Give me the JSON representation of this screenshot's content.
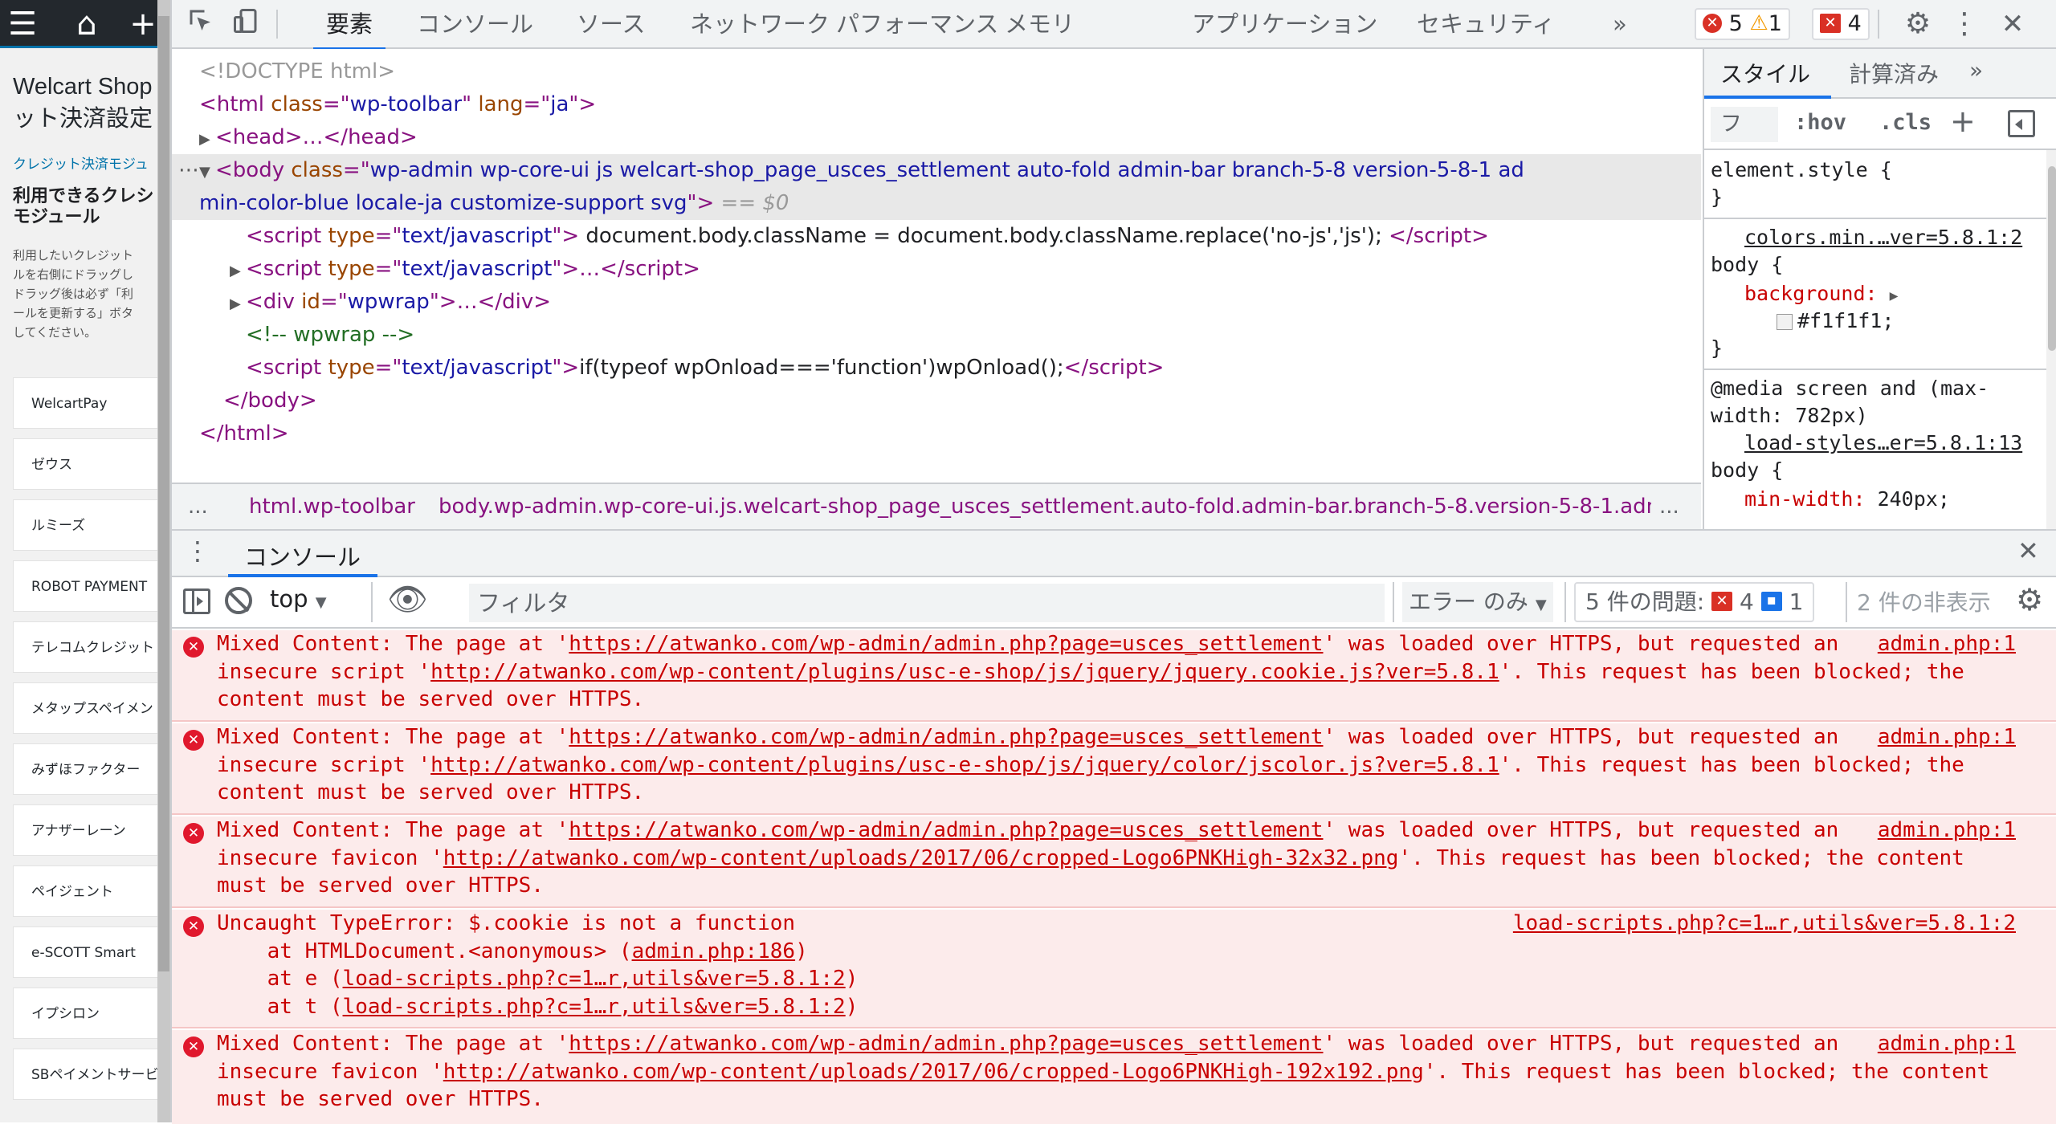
{
  "left_page": {
    "shop_title": "Welcart Shop\nット決済設定",
    "breadcrumb": "クレジット決済モジュ",
    "module_heading": "利用できるクレシ\nモジュール",
    "module_desc": "利用したいクレジット\nルを右側にドラッグし\nドラッグ後は必ず「利\nールを更新する」ボタ\nしてください。",
    "modules": [
      "WelcartPay",
      "ゼウス",
      "ルミーズ",
      "ROBOT PAYMENT",
      "テレコムクレジット",
      "メタップスペイメン",
      "みずほファクター",
      "アナザーレーン",
      "ペイジェント",
      "e-SCOTT Smart",
      "イプシロン",
      "SBペイメントサービ"
    ]
  },
  "devtools": {
    "tabs": [
      "要素",
      "コンソール",
      "ソース",
      "ネットワーク",
      "パフォーマンス",
      "メモリ",
      "アプリケーション",
      "セキュリティ"
    ],
    "more_tabs": "»",
    "issues_badge": {
      "errors": "5",
      "warnings": "1"
    },
    "issues_badge2": {
      "count": "4"
    },
    "elements": {
      "doctype": "<!DOCTYPE html>",
      "html_open_tag": "html",
      "html_attr1": "class",
      "html_attr1_val": "wp-toolbar",
      "html_attr2": "lang",
      "html_attr2_val": "ja",
      "head": "head",
      "body_tag": "body",
      "body_class_attr": "class",
      "body_class_1": "wp-admin wp-core-ui js welcart-shop_page_usces_settlement auto-fold admin-bar branch-5-8 version-5-8-1 ad",
      "body_class_2": "min-color-blue locale-ja customize-support svg",
      "selected_marker": "== $0",
      "script_type_attr": "type",
      "script_type_val": "text/javascript",
      "script1_code": " document.body.className = document.body.className.replace('no-js','js'); ",
      "div_id_attr": "id",
      "div_id_val": "wpwrap",
      "comment": "<!-- wpwrap -->",
      "script3_code": "if(typeof wpOnload==='function')wpOnload();",
      "body_close": "</body>",
      "html_close": "</html>"
    },
    "breadcrumbs": {
      "dots": "...",
      "item1": "html.wp-toolbar",
      "item2": "body.wp-admin.wp-core-ui.js.welcart-shop_page_usces_settlement.auto-fold.admin-bar.branch-5-8.version-5-8-1.admin",
      "trailing": "..."
    },
    "styles_pane": {
      "tabs": [
        "スタイル",
        "計算済み"
      ],
      "more": "»",
      "filter_placeholder": "フ",
      "hov": ":hov",
      "cls": ".cls",
      "plus": "+",
      "element_style": "element.style {",
      "close_brace": "}",
      "rule1_source": "colors.min.…ver=5.8.1:2",
      "rule1_selector": "body {",
      "rule1_prop": "background:",
      "rule1_value": "#f1f1f1;",
      "swatch_color": "#f1f1f1",
      "media_line1": "@media screen and (max-",
      "media_line2": "width: 782px)",
      "rule2_source": "load-styles…er=5.8.1:13",
      "rule2_selector": "body {",
      "rule2_prop": "min-width:",
      "rule2_value": "240px;"
    },
    "drawer": {
      "tab": "コンソール",
      "context": "top",
      "filter_placeholder": "フィルタ",
      "level": "エラー のみ",
      "issues_label": "5 件の問題:",
      "issues_errors": "4",
      "issues_info": "1",
      "hidden_label": "2 件の非表示"
    },
    "console_messages": [
      {
        "prefix": "Mixed Content: The page at '",
        "link1": "https://atwanko.com/wp-admin/admin.php?page=usces_settlement",
        "mid1": "' was loaded over HTTPS, but requested an",
        "line2_prefix": "insecure script '",
        "link2": "http://atwanko.com/wp-content/plugins/usc-e-shop/js/jquery/jquery.cookie.js?ver=5.8.1",
        "line2_suffix": "'. This request has been blocked; the",
        "line3": "content must be served over HTTPS.",
        "source": "admin.php:1"
      },
      {
        "prefix": "Mixed Content: The page at '",
        "link1": "https://atwanko.com/wp-admin/admin.php?page=usces_settlement",
        "mid1": "' was loaded over HTTPS, but requested an",
        "line2_prefix": "insecure script '",
        "link2": "http://atwanko.com/wp-content/plugins/usc-e-shop/js/jquery/color/jscolor.js?ver=5.8.1",
        "line2_suffix": "'. This request has been blocked; the",
        "line3": "content must be served over HTTPS.",
        "source": "admin.php:1"
      },
      {
        "prefix": "Mixed Content: The page at '",
        "link1": "https://atwanko.com/wp-admin/admin.php?page=usces_settlement",
        "mid1": "' was loaded over HTTPS, but requested an",
        "line2_prefix": "insecure favicon '",
        "link2": "http://atwanko.com/wp-content/uploads/2017/06/cropped-Logo6PNKHigh-32x32.png",
        "line2_suffix": "'. This request has been blocked; the content",
        "line3": "must be served over HTTPS.",
        "source": "admin.php:1"
      },
      {
        "line1": "Uncaught TypeError: $.cookie is not a function",
        "at1_prefix": "    at HTMLDocument.<anonymous> (",
        "at1_link": "admin.php:186",
        "at2_prefix": "    at e (",
        "at2_link": "load-scripts.php?c=1…r,utils&ver=5.8.1:2",
        "at3_prefix": "    at t (",
        "at3_link": "load-scripts.php?c=1…r,utils&ver=5.8.1:2",
        "close": ")",
        "source": "load-scripts.php?c=1…r,utils&ver=5.8.1:2"
      },
      {
        "prefix": "Mixed Content: The page at '",
        "link1": "https://atwanko.com/wp-admin/admin.php?page=usces_settlement",
        "mid1": "' was loaded over HTTPS, but requested an",
        "line2_prefix": "insecure favicon '",
        "link2": "http://atwanko.com/wp-content/uploads/2017/06/cropped-Logo6PNKHigh-192x192.png",
        "line2_suffix": "'. This request has been blocked; the content",
        "line3": "must be served over HTTPS.",
        "source": "admin.php:1"
      }
    ]
  },
  "colors": {
    "accent": "#1a73e8",
    "error_bg": "#fcebeb",
    "error_text": "#c80000",
    "wp_admin_bar": "#23282d"
  }
}
